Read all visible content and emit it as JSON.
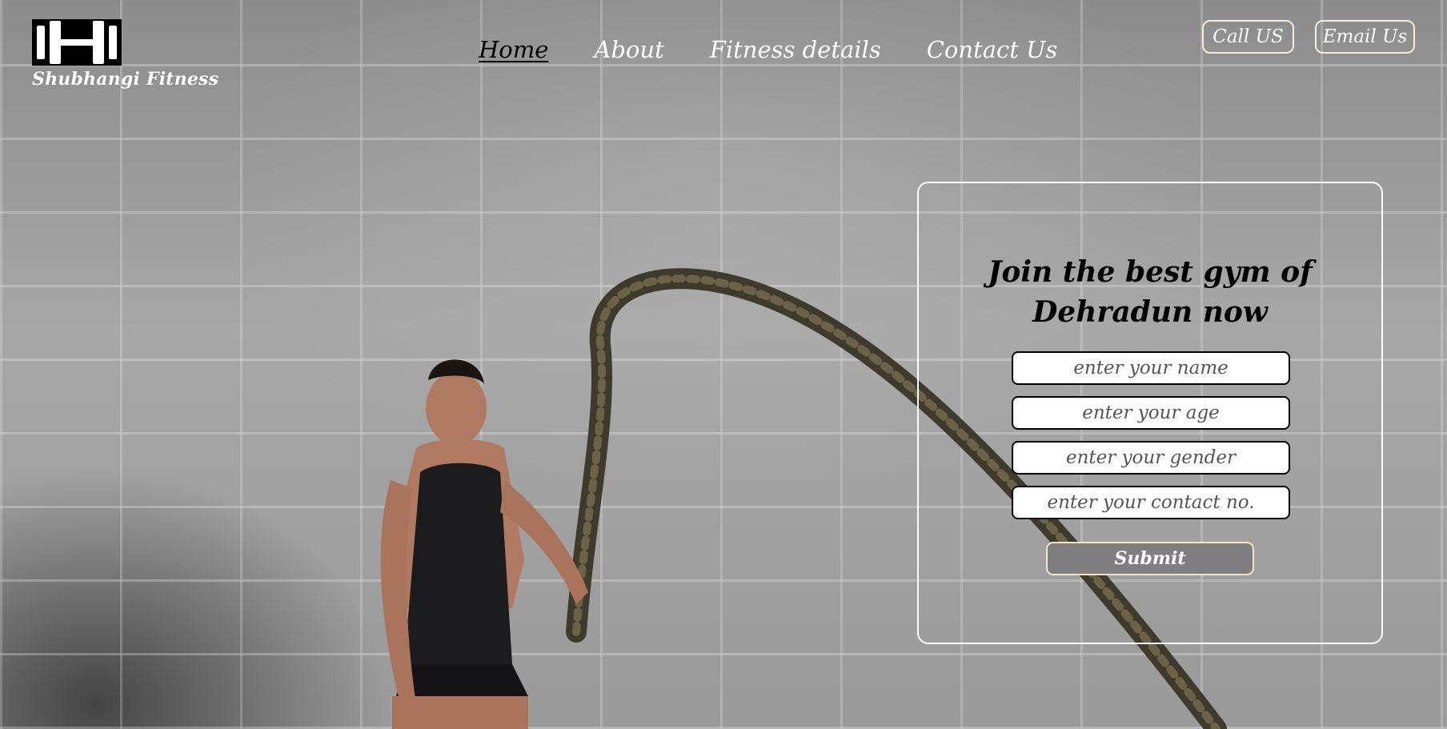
{
  "brand": {
    "name": "Shubhangi Fitness",
    "logo_icon": "dumbbell-icon"
  },
  "nav": [
    {
      "label": "Home",
      "active": true
    },
    {
      "label": "About",
      "active": false
    },
    {
      "label": "Fitness details",
      "active": false
    },
    {
      "label": "Contact Us",
      "active": false
    }
  ],
  "actions": {
    "call_label": "Call US",
    "email_label": "Email Us"
  },
  "form": {
    "heading": "Join the best gym of Dehradun now",
    "name_placeholder": "enter your name",
    "age_placeholder": "enter your age",
    "gender_placeholder": "enter your gender",
    "contact_placeholder": "enter your contact no.",
    "submit_label": "Submit"
  },
  "colors": {
    "accent_border": "#f5efd8",
    "submit_bg": "#7f7f7f",
    "nav_active": "#000000",
    "nav_text": "#ffffff"
  }
}
